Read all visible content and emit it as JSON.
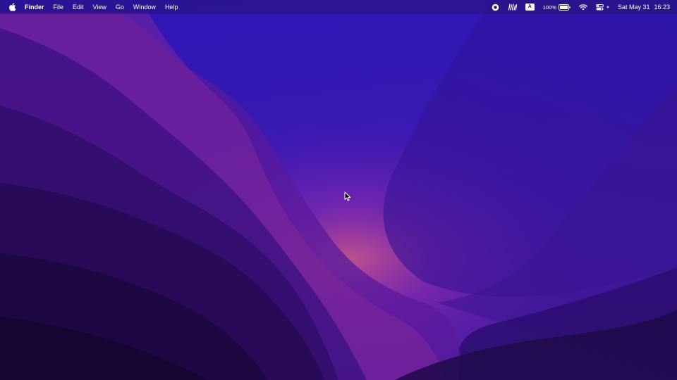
{
  "menubar": {
    "app_name": "Finder",
    "menus": [
      "File",
      "Edit",
      "View",
      "Go",
      "Window",
      "Help"
    ],
    "status_items": [
      {
        "icon": "screen-record-icon"
      },
      {
        "icon": "audio-waveform-icon"
      },
      {
        "icon": "input-source-icon",
        "text": "A"
      },
      {
        "icon": "battery-icon",
        "text": "100%",
        "level": 1.0
      },
      {
        "icon": "wifi-icon"
      },
      {
        "icon": "control-center-icon"
      }
    ],
    "date": "Sat May 31",
    "time": "16:23"
  },
  "wallpaper": {
    "name": "macOS Monterey",
    "colors": [
      "#1b0848",
      "#2f14a8",
      "#6a1aa8",
      "#c44f86"
    ]
  }
}
